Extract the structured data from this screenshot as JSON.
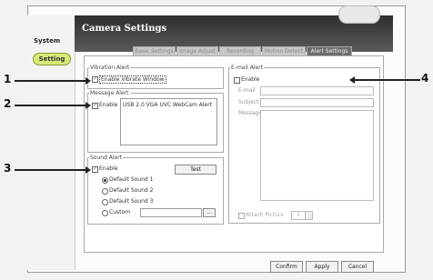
{
  "window": {
    "title": "Camera Settings"
  },
  "sidebar": {
    "items": [
      {
        "label": "System"
      },
      {
        "label": "Setting"
      }
    ]
  },
  "tabs": [
    {
      "label": "Basic Settings"
    },
    {
      "label": "Image Adjust"
    },
    {
      "label": "Recording"
    },
    {
      "label": "Motion Detect"
    },
    {
      "label": "Alert Settings"
    }
  ],
  "vibration_alert": {
    "title": "Vibration Alert",
    "enable_label": "Enable Vibrate Window",
    "checked": true
  },
  "message_alert": {
    "title": "Message Alert",
    "enable_label": "Enable",
    "checked": true,
    "message": "USB 2.0 VGA UVC WebCam Alert"
  },
  "sound_alert": {
    "title": "Sound Alert",
    "enable_label": "Enable",
    "checked": true,
    "test_label": "Test",
    "options": [
      {
        "label": "Default Sound 1",
        "selected": true
      },
      {
        "label": "Default Sound 2",
        "selected": false
      },
      {
        "label": "Default Sound 3",
        "selected": false
      },
      {
        "label": "Custom",
        "selected": false
      }
    ],
    "custom_value": "",
    "browse_label": "..."
  },
  "email_alert": {
    "title": "E-mail Alert",
    "enable_label": "Enable",
    "checked": false,
    "email_label": "E-mail",
    "subject_label": "Subject",
    "message_label": "Message",
    "email_value": "",
    "subject_value": "",
    "message_value": "",
    "attach_label": "Attach Picture",
    "attach_count": "1"
  },
  "buttons": {
    "confirm": "Confirm",
    "apply": "Apply",
    "cancel": "Cancel"
  },
  "callouts": [
    "1",
    "2",
    "3",
    "4"
  ]
}
